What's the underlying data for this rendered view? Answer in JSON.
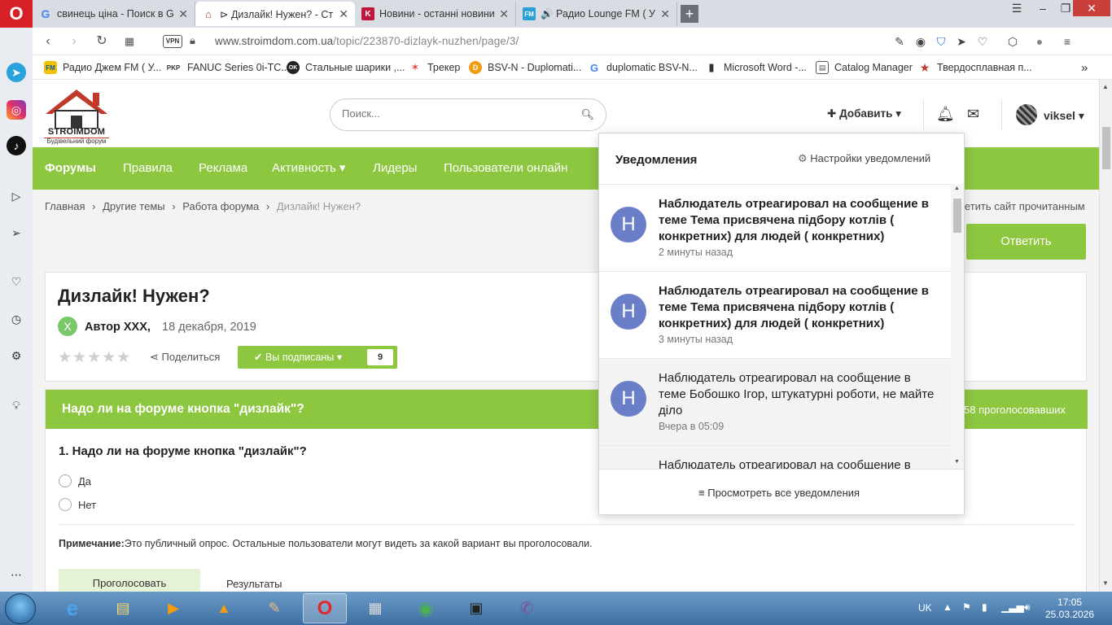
{
  "browser": {
    "tabs": [
      {
        "title": "свинець ціна - Поиск в Go",
        "icon": "google-g",
        "color": "#4285f4"
      },
      {
        "title": "⊳ Дизлайк! Нужен? - Стра",
        "icon": "stroimdom-house",
        "color": "#c0392b"
      },
      {
        "title": "Новини - останні новини",
        "icon": "letter-k",
        "color": "#c0143c"
      },
      {
        "title": "🔊 Радио Lounge FM ( Укр",
        "icon": "fm-logo",
        "color": "#2aa0d6"
      }
    ],
    "url_domain": "www.stroimdom.com.ua",
    "url_path": "/topic/223870-dizlayk-nuzhen/page/3/",
    "vpn_label": "VPN",
    "bookmarks": [
      {
        "label": "Радио Джем FM ( У...",
        "icon": "fm-icon"
      },
      {
        "label": "FANUC Series 0i-TC...",
        "icon": "rkr-icon"
      },
      {
        "label": "Стальные шарики ,...",
        "icon": "ok-icon"
      },
      {
        "label": "Трекер",
        "icon": "star-icon"
      },
      {
        "label": "BSV-N - Duplomati...",
        "icon": "d-icon"
      },
      {
        "label": "duplomatic BSV-N...",
        "icon": "google-icon"
      },
      {
        "label": "Microsoft Word -...",
        "icon": "doc-icon"
      },
      {
        "label": "Catalog Manager",
        "icon": "catalog-icon"
      },
      {
        "label": "Твердосплавная п...",
        "icon": "star-red-icon"
      }
    ],
    "bookmarks_more": "»"
  },
  "site": {
    "logo_text": "STROIMDOM",
    "logo_subtitle": "Будівельний форум",
    "search_placeholder": "Поиск...",
    "add_label": "Добавить",
    "username": "viksel",
    "nav": [
      "Форумы",
      "Правила",
      "Реклама",
      "Активность",
      "Лидеры",
      "Пользователи онлайн"
    ],
    "breadcrumb": [
      "Главная",
      "Другие темы",
      "Работа форума",
      "Дизлайк! Нужен?"
    ],
    "mark_read": "тметить сайт прочитанным",
    "reply_button": "Ответить"
  },
  "topic": {
    "title": "Дизлайк! Нужен?",
    "author_initial": "X",
    "author": "Автор XXX,",
    "date": "18 декабря, 2019",
    "share": "Поделиться",
    "subscribed": "Вы подписаны",
    "subscribers": "9"
  },
  "poll": {
    "header": "Надо ли на форуме кнопка \"дизлайк\"?",
    "voters": "58 проголосовавших",
    "question": "1. Надо ли на форуме кнопка \"дизлайк\"?",
    "options": [
      "Да",
      "Нет"
    ],
    "note_label": "Примечание:",
    "note_text": "Это публичный опрос. Остальные пользователи могут видеть за какой вариант вы проголосовали.",
    "vote_button": "Проголосовать",
    "results_button": "Результаты"
  },
  "notifications": {
    "title": "Уведомления",
    "settings": "Настройки уведомлений",
    "items": [
      {
        "initial": "Н",
        "text": "Наблюдатель отреагировал на сообщение в теме Тема присвячена підбору котлів ( конкретних) для людей ( конкретних)",
        "time": "2 минуты назад",
        "unread": true
      },
      {
        "initial": "Н",
        "text": "Наблюдатель отреагировал на сообщение в теме Тема присвячена підбору котлів ( конкретних) для людей ( конкретних)",
        "time": "3 минуты назад",
        "unread": true
      },
      {
        "initial": "Н",
        "text": "Наблюдатель отреагировал на сообщение в теме Бобошко Ігор, штукатурні роботи, не майте діло",
        "time": "Вчера в 05:09",
        "unread": false
      },
      {
        "initial": "",
        "text": "Наблюдатель отреагировал на сообщение в",
        "time": "",
        "unread": false
      }
    ],
    "view_all": "Просмотреть все уведомления"
  },
  "taskbar": {
    "lang": "UK",
    "time": "17:05",
    "date": "25.03.2026"
  }
}
